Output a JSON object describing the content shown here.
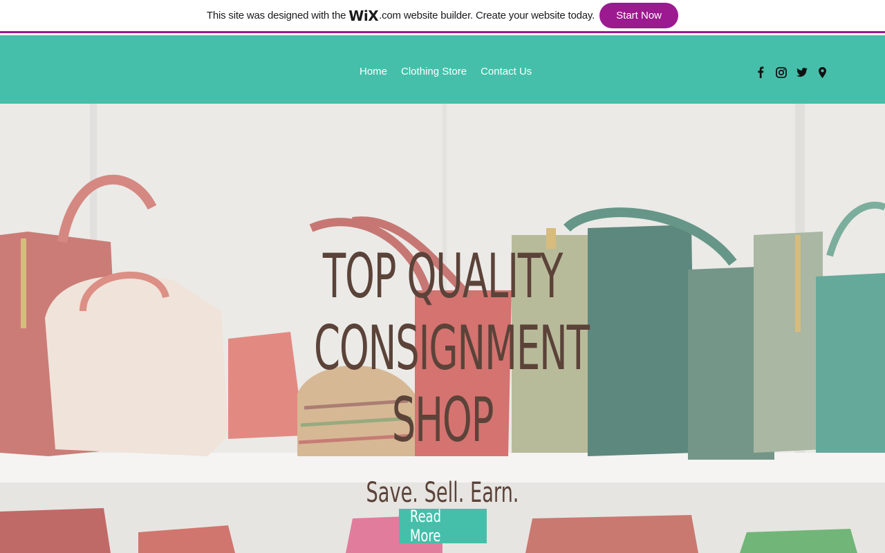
{
  "banner": {
    "text_before": "This site was designed with the",
    "logo": "WiX",
    "text_after": ".com website builder. Create your website today.",
    "cta_label": "Start Now",
    "accent_color": "#9b1a8f"
  },
  "header": {
    "background_color": "#45bfaa",
    "nav": [
      {
        "label": "Home"
      },
      {
        "label": "Clothing Store"
      },
      {
        "label": "Contact Us"
      }
    ],
    "social_icons": [
      "facebook-icon",
      "instagram-icon",
      "twitter-icon",
      "map-pin-icon"
    ]
  },
  "hero": {
    "title_line1": "TOP QUALITY",
    "title_line2": "CONSIGNMENT",
    "title_line3": "SHOP",
    "subtitle": "Save. Sell. Earn.",
    "button_label": "Read More",
    "text_color": "#5b4339"
  }
}
